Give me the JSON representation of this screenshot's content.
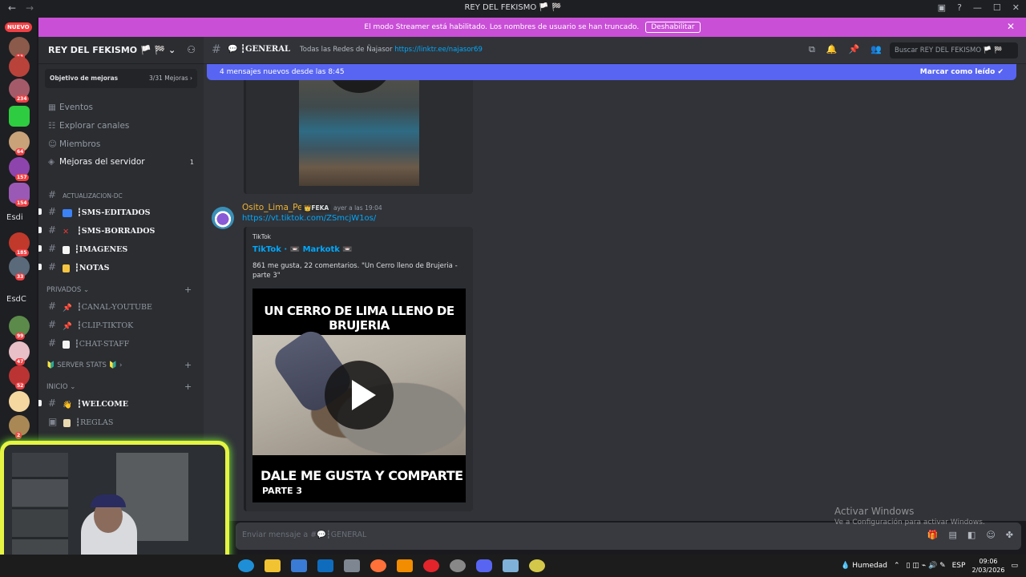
{
  "window": {
    "title": "REY DEL FEKISMO 🏳️ 🏁",
    "back": "←",
    "forward": "→",
    "controls": [
      "—",
      "☐",
      "✕"
    ]
  },
  "rail": {
    "nuevo": "NUEVO",
    "servers": [
      {
        "badge": "11",
        "color": "#8b5a4a"
      },
      {
        "badge": "",
        "color": "#b9423a"
      },
      {
        "badge": "234",
        "color": "#a55a6a"
      },
      {
        "badge": "",
        "color": "#2ecc40"
      },
      {
        "badge": "64",
        "color": "#c9a27a"
      },
      {
        "badge": "157",
        "color": "#8e44ad"
      },
      {
        "badge": "154",
        "color": "#9b59b6"
      }
    ],
    "text1": "Esdi",
    "servers2": [
      {
        "badge": "185",
        "color": "#c0392b"
      },
      {
        "badge": "33",
        "color": "#5a6a7a"
      }
    ],
    "text2": "EsdC",
    "servers3": [
      {
        "badge": "99",
        "color": "#5b8a4a"
      },
      {
        "badge": "47",
        "color": "#e8c0c8"
      },
      {
        "badge": "52",
        "color": "#b33"
      },
      {
        "badge": "",
        "color": "#f5d7a0"
      },
      {
        "badge": "2",
        "color": "#a85"
      }
    ]
  },
  "banner": {
    "message": "El modo Streamer está habilitado. Los nombres de usuario se han truncado.",
    "button": "Deshabilitar",
    "close": "✕"
  },
  "sidebar": {
    "server_name": "REY DEL FEKISMO 🏳️ 🏁 ⌄",
    "goal_label": "Objetivo de mejoras",
    "goal_value": "3/31 Mejoras ›",
    "nav": [
      "Eventos",
      "Explorar canales",
      "Miembros",
      "Mejoras del servidor"
    ],
    "mejoras_count": "1",
    "cat_actualizacion": "ACTUALIZACION-DC",
    "channels_a": [
      "┇SMS-EDITADOS",
      "┇SMS-BORRADOS",
      "┇IMAGENES",
      "┇NOTAS"
    ],
    "cat_privados": "PRIVADOS ⌄",
    "channels_b": [
      "┇CANAL-YOUTUBE",
      "┇CLIP-TIKTOK",
      "┇CHAT-STAFF"
    ],
    "cat_stats": "🔰 SERVER STATS 🔰 ›",
    "cat_inicio": "INICIO ⌄",
    "channels_c": [
      "┇WELCOME",
      "┇REGLAS"
    ]
  },
  "header": {
    "channel": "┇GENERAL",
    "topic": "Todas las Redes de Ñajasor",
    "topic_link": "https://linktr.ee/najasor69",
    "search_placeholder": "Buscar REY DEL FEKISMO 🏳️ 🏁"
  },
  "newbar": {
    "text": "4 mensajes nuevos desde las 8:45",
    "mark": "Marcar como leído"
  },
  "message": {
    "author": "Osito_Lima_Pe",
    "tag": "👑FEKA",
    "time": "ayer a las 19:04",
    "link": "https://vt.tiktok.com/ZSmcjW1os/",
    "embed": {
      "provider": "TikTok",
      "author": "TikTok · 📼 Markotk 📼",
      "description": "861 me gusta, 22 comentarios. \"Un Cerro lleno de Brujeria - parte 3\"",
      "video_top": "UN CERRO DE LIMA LLENO DE BRUJERIA",
      "video_bottom": "DALE ME GUSTA Y COMPARTE",
      "video_part": "PARTE 3"
    }
  },
  "input": {
    "placeholder": "Enviar mensaje a #💬┇GENERAL"
  },
  "watermark": {
    "line1": "Activar Windows",
    "line2": "Ve a Configuración para activar Windows."
  },
  "taskbar": {
    "weather": "💧 Humedad",
    "lang": "ESP",
    "time": "09:06",
    "date": "2/03/2026"
  }
}
